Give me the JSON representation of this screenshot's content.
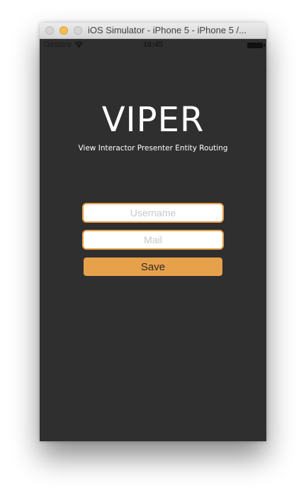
{
  "window": {
    "title": "iOS Simulator - iPhone 5 - iPhone 5 /..."
  },
  "statusbar": {
    "carrier": "Gestore",
    "time": "16:45",
    "wifi_icon": "wifi-icon",
    "battery_icon": "battery-icon"
  },
  "app": {
    "logo": "VIPER",
    "subtitle": "View Interactor Presenter Entity Routing",
    "username_placeholder": "Username",
    "mail_placeholder": "Mail",
    "save_label": "Save"
  },
  "colors": {
    "background": "#2f2f2f",
    "accent": "#e8a14b"
  }
}
